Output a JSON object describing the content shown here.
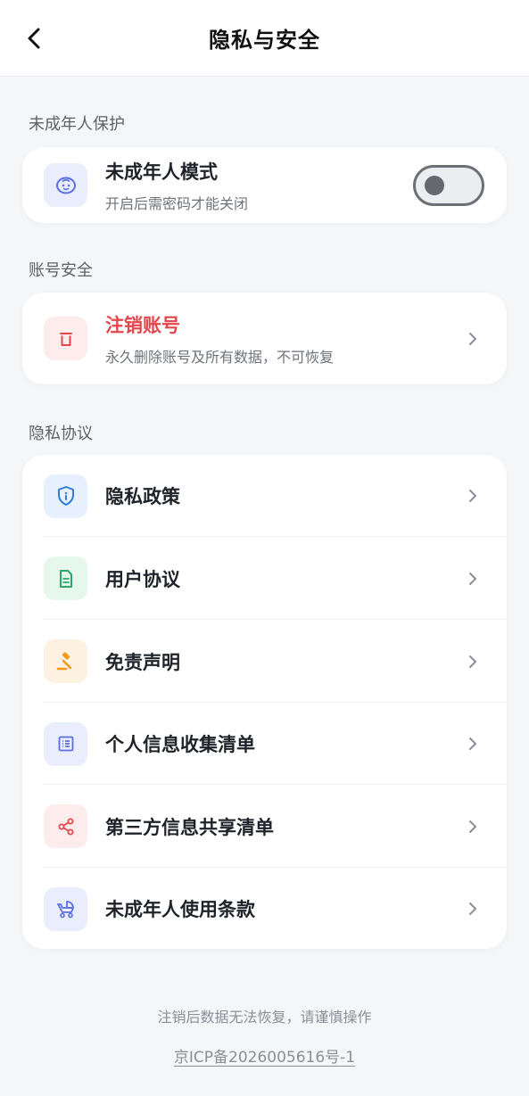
{
  "header": {
    "title": "隐私与安全",
    "back_icon": "chevron-left-icon"
  },
  "sections": {
    "minor": {
      "title": "未成年人保护",
      "item": {
        "label": "未成年人模式",
        "sub": "开启后需密码才能关闭",
        "icon": "baby-face-icon",
        "toggle_on": false
      }
    },
    "account": {
      "title": "账号安全",
      "item": {
        "label": "注销账号",
        "sub": "永久删除账号及所有数据，不可恢复",
        "icon": "trash-icon",
        "label_color": "#e0474c"
      }
    },
    "privacy": {
      "title": "隐私协议",
      "items": [
        {
          "label": "隐私政策",
          "icon": "shield-icon"
        },
        {
          "label": "用户协议",
          "icon": "document-icon"
        },
        {
          "label": "免责声明",
          "icon": "gavel-icon"
        },
        {
          "label": "个人信息收集清单",
          "icon": "list-icon"
        },
        {
          "label": "第三方信息共享清单",
          "icon": "share-icon"
        },
        {
          "label": "未成年人使用条款",
          "icon": "stroller-icon"
        }
      ]
    }
  },
  "footer": {
    "note": "注销后数据无法恢复，请谨慎操作",
    "icp": "京ICP备2026005616号-1"
  },
  "colors": {
    "accent_red": "#e0474c",
    "page_bg": "#f5f6f8",
    "card_bg": "#ffffff"
  }
}
